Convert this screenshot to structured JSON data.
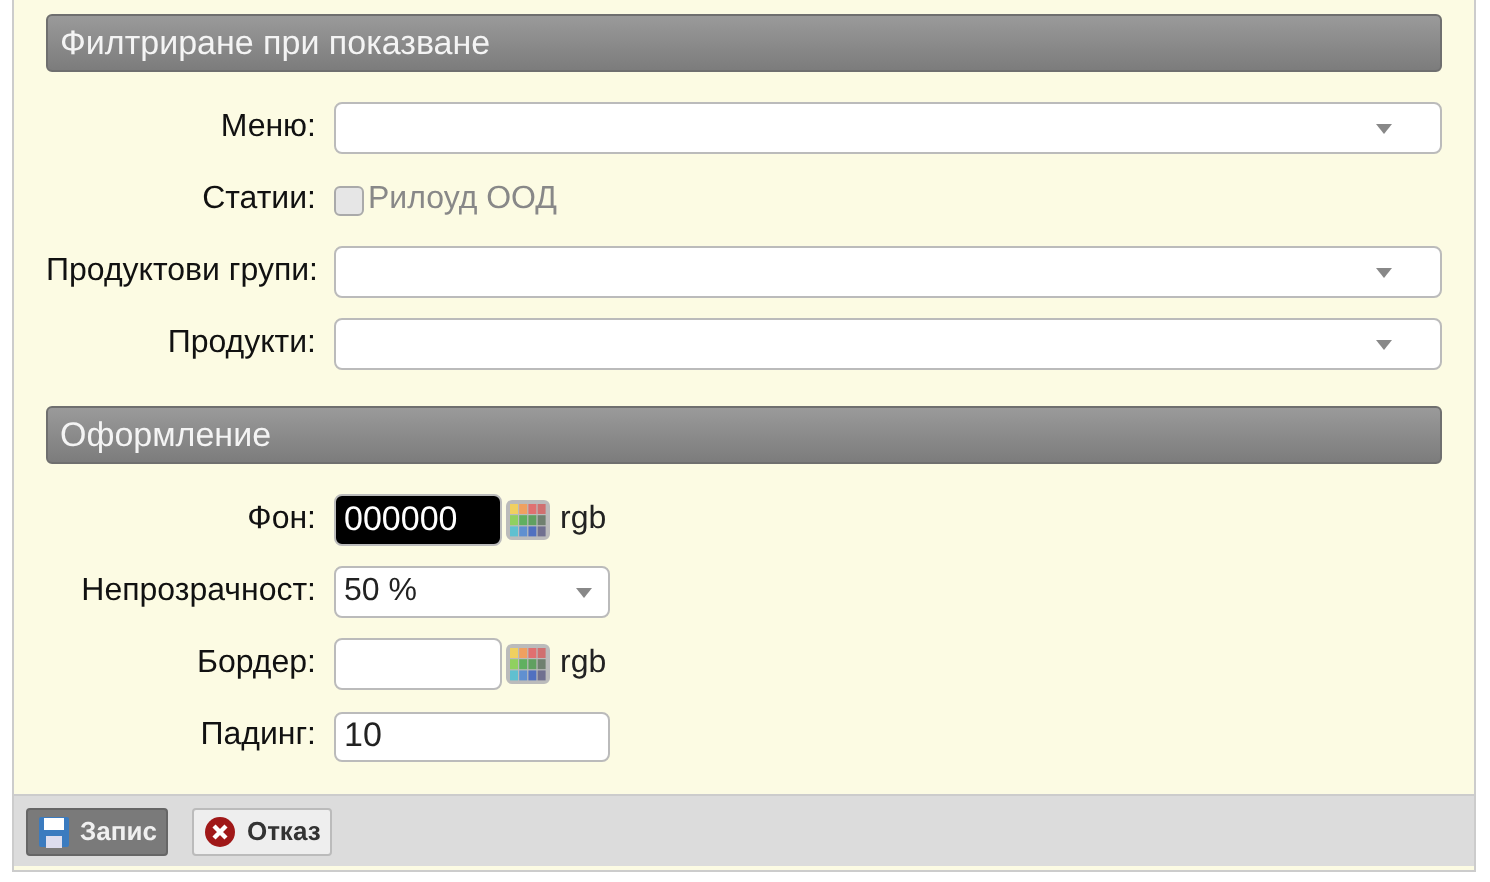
{
  "sections": [
    {
      "title": "Филтриране при показване",
      "fields": [
        {
          "kind": "wideselect",
          "label": "Меню:"
        },
        {
          "kind": "checkbox",
          "label": "Статии:",
          "option": "Рилоуд ООД",
          "checked": false,
          "disabled": true
        },
        {
          "kind": "wideselect",
          "label": "Продуктови групи:"
        },
        {
          "kind": "wideselect",
          "label": "Продукти:"
        }
      ]
    },
    {
      "title": "Оформление",
      "fields": [
        {
          "kind": "color",
          "label": "Фон:",
          "value": "000000",
          "color": "#000000",
          "suffix": "rgb"
        },
        {
          "kind": "select",
          "label": "Непрозрачност:",
          "value": "50 %"
        },
        {
          "kind": "color",
          "label": "Бордер:",
          "suffix": "rgb"
        },
        {
          "kind": "text",
          "label": "Падинг:",
          "value": "10"
        }
      ]
    }
  ],
  "buttons": [
    {
      "label": "Запис",
      "kind": "save"
    },
    {
      "label": "Отказ",
      "kind": "cancel"
    }
  ]
}
